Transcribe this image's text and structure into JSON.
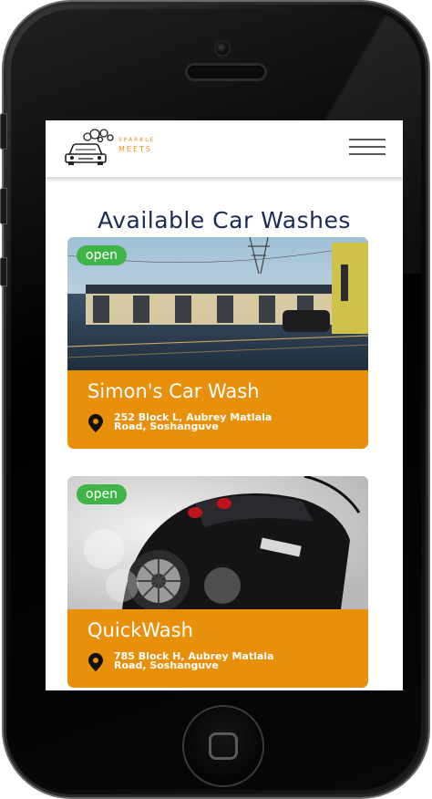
{
  "brand": {
    "line1": "SPARKLE",
    "line2": "MEETS"
  },
  "page_title": "Available Car Washes",
  "cards": [
    {
      "status": "open",
      "name": "Simon's Car Wash",
      "address_line1": "252 Block L, Aubrey Matlala",
      "address_line2": "Road, Soshanguve",
      "icon": "location-pin-icon"
    },
    {
      "status": "open",
      "name": "QuickWash",
      "address_line1": "785 Block H, Aubrey Matlala",
      "address_line2": "Road, Soshanguve",
      "icon": "location-pin-icon"
    }
  ],
  "colors": {
    "accent": "#e8900c",
    "title": "#1c2a56",
    "badge": "#3fb548",
    "brand": "#e38e12"
  },
  "icons": {
    "menu": "hamburger-menu-icon",
    "logo": "car-wash-logo-icon"
  }
}
